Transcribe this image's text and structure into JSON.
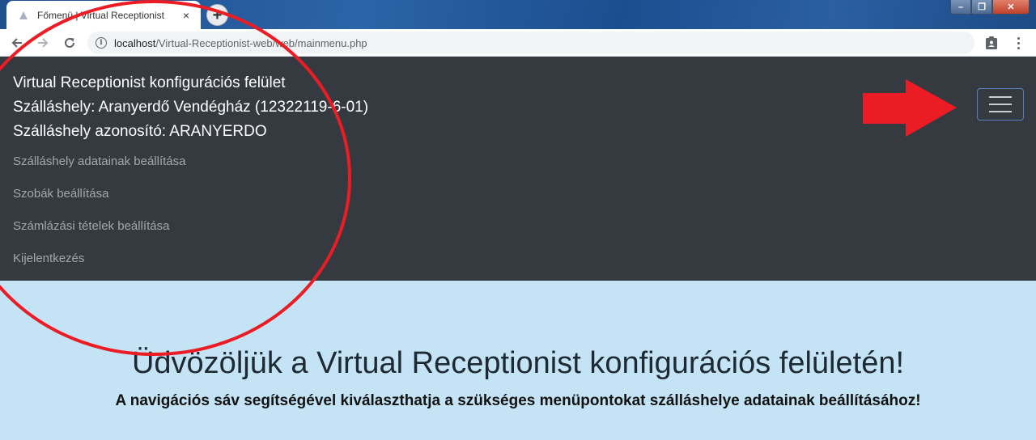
{
  "browser": {
    "tab_title": "Főmenü | Virtual Receptionist",
    "tab_close": "×",
    "new_tab": "+",
    "url_host": "localhost",
    "url_path": "/Virtual-Receptionist-web/web/mainmenu.php",
    "window_controls": {
      "minimize": "–",
      "maximize": "❐",
      "close": "✕"
    }
  },
  "navbar": {
    "brand_line1": "Virtual Receptionist konfigurációs felület",
    "brand_line2": "Szálláshely: Aranyerdő Vendégház (12322119-6-01)",
    "brand_line3": "Szálláshely azonosító: ARANYERDO",
    "links": [
      {
        "label": "Szálláshely adatainak beállítása"
      },
      {
        "label": "Szobák beállítása"
      },
      {
        "label": "Számlázási tételek beállítása"
      },
      {
        "label": "Kijelentkezés"
      }
    ]
  },
  "main": {
    "title": "Üdvözöljük a Virtual Receptionist konfigurációs felületén!",
    "subtitle": "A navigációs sáv segítségével kiválaszthatja a szükséges menüpontokat szálláshelye adatainak beállításához!"
  },
  "colors": {
    "navbar_bg": "#343a40",
    "page_bg": "#c4e3f4",
    "annotation_red": "#ec1c24"
  },
  "icons": [
    "favicon-icon",
    "close-icon",
    "plus-icon",
    "back-arrow-icon",
    "forward-arrow-icon",
    "reload-icon",
    "info-icon",
    "extension-icon",
    "kebab-menu-icon",
    "hamburger-icon",
    "annotation-arrow-icon",
    "annotation-circle-icon"
  ]
}
